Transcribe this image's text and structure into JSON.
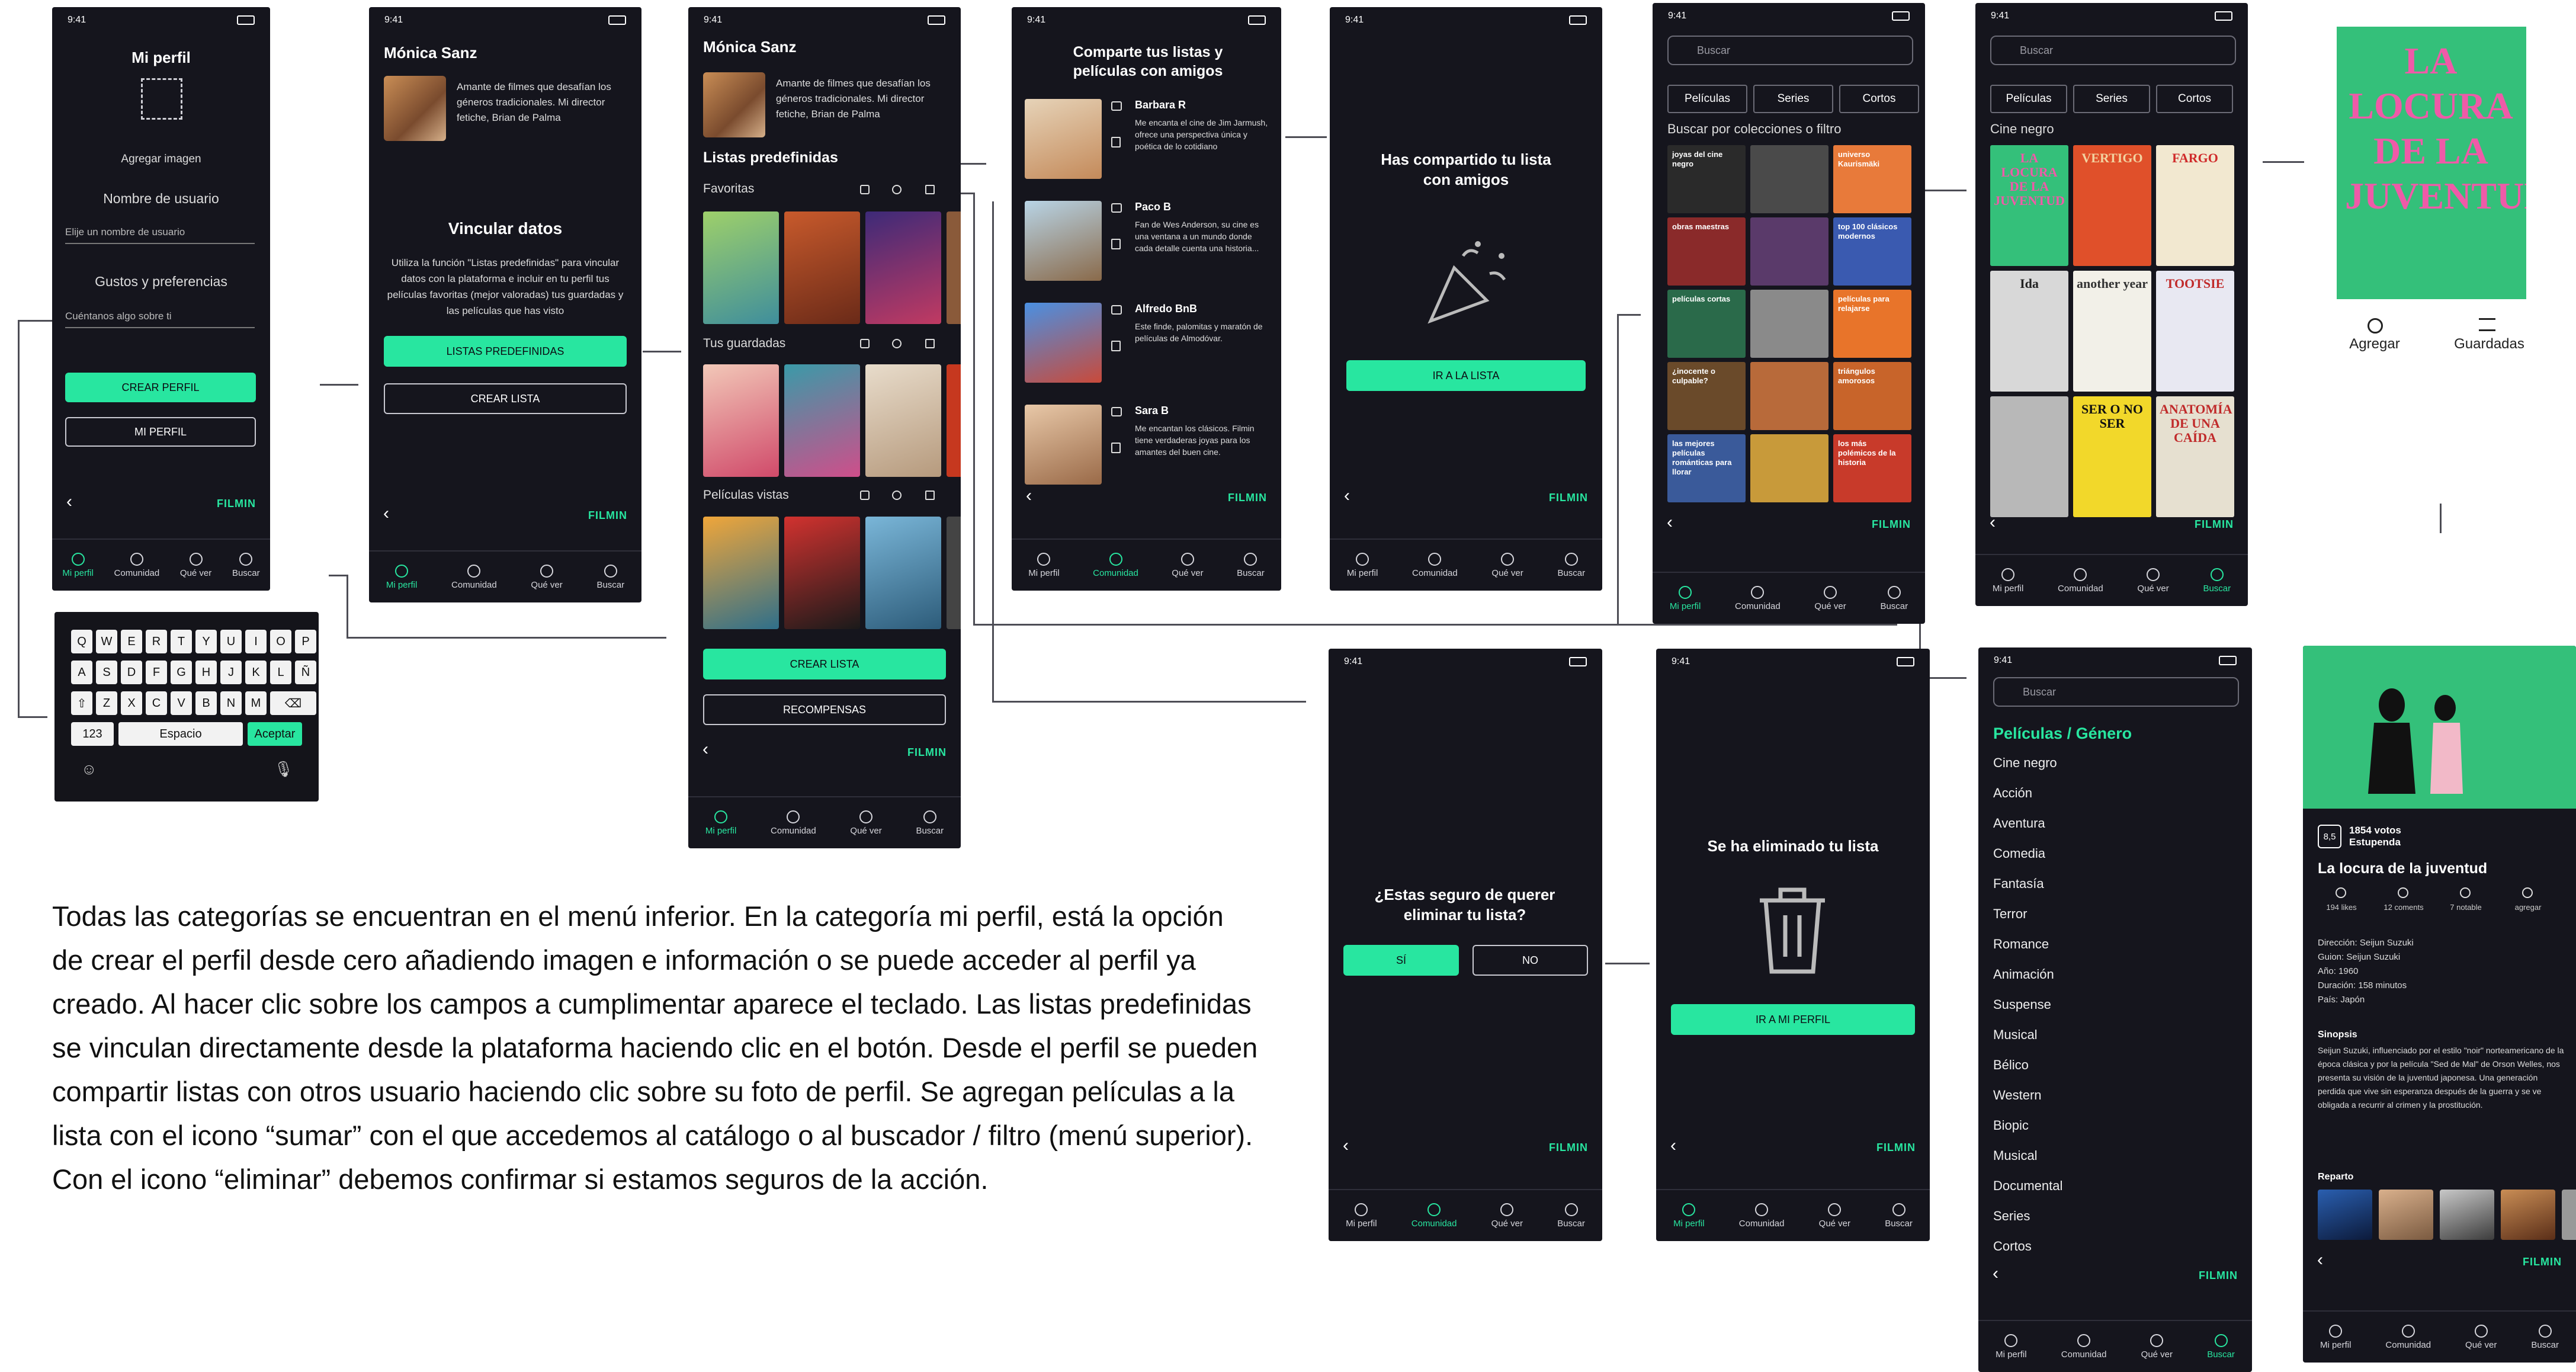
{
  "status": {
    "time": "9:41"
  },
  "nav": {
    "profile": "Mi perfil",
    "community": "Comunidad",
    "watch": "Qué ver",
    "search": "Buscar"
  },
  "logo": "FILMIN",
  "s1": {
    "title": "Mi perfil",
    "add_image": "Agregar imagen",
    "username_label": "Nombre de usuario",
    "username_placeholder": "Elije un nombre de usuario",
    "tastes_label": "Gustos y preferencias",
    "tastes_placeholder": "Cuéntanos algo sobre ti",
    "create_btn": "CREAR PERFIL",
    "profile_btn": "MI PERFIL"
  },
  "keyboard": {
    "row1": [
      "Q",
      "W",
      "E",
      "R",
      "T",
      "Y",
      "U",
      "I",
      "O",
      "P"
    ],
    "row2": [
      "A",
      "S",
      "D",
      "F",
      "G",
      "H",
      "J",
      "K",
      "L",
      "Ñ"
    ],
    "row3": [
      "Z",
      "X",
      "C",
      "V",
      "B",
      "N",
      "M"
    ],
    "num": "123",
    "space": "Espacio",
    "accept": "Aceptar"
  },
  "s2": {
    "name": "Mónica Sanz",
    "bio": "Amante de filmes que desafían los géneros tradicionales. Mi director fetiche, Brian de Palma",
    "link_title": "Vincular datos",
    "link_text": "Utiliza la función \"Listas predefinidas\" para vincular datos con la plataforma e incluir en tu perfil tus películas favoritas (mejor valoradas) tus guardadas y las películas que has visto",
    "predef_btn": "LISTAS PREDEFINIDAS",
    "create_list_btn": "CREAR LISTA"
  },
  "s3": {
    "name": "Mónica Sanz",
    "bio": "Amante de filmes que desafían los géneros tradicionales. Mi director fetiche, Brian de Palma",
    "section": "Listas predefinidas",
    "fav": "Favoritas",
    "saved": "Tus guardadas",
    "seen": "Películas vistas",
    "create_btn": "CREAR LISTA",
    "rewards_btn": "RECOMPENSAS"
  },
  "s4": {
    "title": "Comparte tus listas y películas con amigos",
    "friends": [
      {
        "name": "Barbara R",
        "text": "Me encanta el cine de Jim Jarmush, ofrece una perspectiva única y poética de lo cotidiano"
      },
      {
        "name": "Paco B",
        "text": "Fan de Wes Anderson, su cine es una ventana a un mundo donde cada detalle cuenta una historia..."
      },
      {
        "name": "Alfredo BnB",
        "text": "Este finde, palomitas y maratón de películas de Almodóvar."
      },
      {
        "name": "Sara B",
        "text": "Me encantan los clásicos. Filmin tiene verdaderas joyas para los amantes del buen cine."
      }
    ]
  },
  "s5": {
    "title": "Has compartido tu lista con amigos",
    "btn": "IR A LA LISTA"
  },
  "s6": {
    "search": "Buscar",
    "chips": [
      "Películas",
      "Series",
      "Cortos"
    ],
    "heading": "Buscar por colecciones o filtro",
    "tiles": [
      "joyas del cine negro",
      "",
      "universo Kaurismäki",
      "obras maestras",
      "",
      "top 100 clásicos modernos",
      "películas cortas",
      "",
      "películas para relajarse",
      "¿inocente o culpable?",
      "",
      "triángulos amorosos",
      "las mejores películas románticas para llorar",
      "",
      "los más polémicos de la historia"
    ]
  },
  "s7": {
    "search": "Buscar",
    "chips": [
      "Películas",
      "Series",
      "Cortos"
    ],
    "heading": "Cine negro",
    "posters": [
      "LA LOCURA DE LA JUVENTUD",
      "VERTIGO",
      "FARGO",
      "Ida",
      "another year",
      "TOOTSIE",
      "",
      "SER O NO SER",
      "ANATOMÍA DE UNA CAÍDA"
    ]
  },
  "s8": {
    "poster_title": "LA LOCURA DE LA JUVENTUD",
    "add": "Agregar",
    "saved": "Guardadas"
  },
  "s9": {
    "question": "¿Estas seguro de querer eliminar tu lista?",
    "yes": "SÍ",
    "no": "NO"
  },
  "s10": {
    "message": "Se ha eliminado tu lista",
    "btn": "IR A MI PERFIL"
  },
  "s11": {
    "search": "Buscar",
    "heading": "Películas / Género",
    "genres": [
      "Cine negro",
      "Acción",
      "Aventura",
      "Comedia",
      "Fantasía",
      "Terror",
      "Romance",
      "Animación",
      "Suspense",
      "Musical",
      "Bélico",
      "Western",
      "Biopic",
      "Musical",
      "Documental",
      "Series",
      "Cortos"
    ]
  },
  "s12": {
    "score": "8,5",
    "votes": "1854 votos",
    "rating": "Estupenda",
    "title": "La locura de la juventud",
    "stats": [
      "194 likes",
      "12 coments",
      "7 notable",
      "agregar"
    ],
    "director": "Dirección: Seijun Suzuki",
    "script": "Guion: Seijun Suzuki",
    "year": "Año: 1960",
    "duration": "Duración: 158 minutos",
    "country": "País: Japón",
    "synopsis_label": "Sinopsis",
    "synopsis": "Seijun Suzuki, influenciado por el estilo \"noir\" norteamericano de la época clásica y por la película \"Sed de Mal\" de Orson Welles, nos presenta su visión de la juventud japonesa. Una generación perdida que vive sin esperanza después de la guerra y se ve obligada a recurrir al crimen y la prostitución.",
    "cast_label": "Reparto"
  },
  "description": "Todas las categorías se encuentran en el menú inferior. En la categoría mi perfil, está la opción de crear el perfil desde cero añadiendo imagen e información o se puede acceder al perfil ya creado. Al hacer clic sobre los campos a cumplimentar aparece el teclado. Las listas predefinidas se vinculan directamente desde la plataforma haciendo clic en el botón. Desde el perfil se pueden compartir listas con otros usuario haciendo clic sobre su foto de perfil. Se agregan películas a la lista con el icono “sumar” con el que accedemos al catálogo o al buscador / filtro (menú superior). Con el icono “eliminar” debemos confirmar si estamos seguros de la acción.",
  "colors": {
    "accent": "#28e6a0",
    "bg": "#15151d",
    "poster_pink": "#ef5aa8",
    "poster_green": "#34c07a"
  }
}
